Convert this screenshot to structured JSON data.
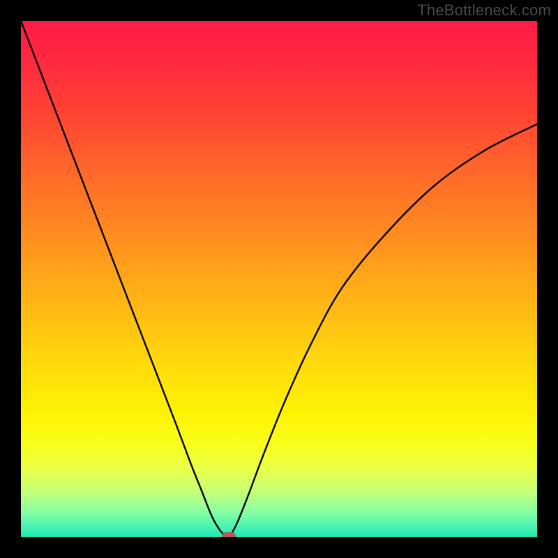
{
  "watermark": "TheBottleneck.com",
  "colors": {
    "frame_bg": "#000000",
    "curve": "#000000",
    "marker": "#b55a5a"
  },
  "chart_data": {
    "type": "line",
    "title": "",
    "xlabel": "",
    "ylabel": "",
    "xlim": [
      0,
      100
    ],
    "ylim": [
      0,
      100
    ],
    "grid": false,
    "legend": false,
    "series": [
      {
        "name": "bottleneck-curve",
        "x": [
          0,
          5,
          10,
          15,
          20,
          25,
          30,
          33,
          35,
          37,
          38.5,
          39.5,
          40.3,
          41,
          42,
          44,
          47,
          51,
          56,
          62,
          70,
          80,
          90,
          100
        ],
        "y": [
          100,
          87,
          74,
          61,
          48,
          35,
          22,
          14,
          9,
          4,
          1.4,
          0.4,
          0,
          1,
          3,
          8,
          16,
          26,
          37,
          48,
          58,
          68,
          75,
          80
        ]
      }
    ],
    "marker": {
      "x": 40.3,
      "y": 0
    },
    "annotations": []
  }
}
